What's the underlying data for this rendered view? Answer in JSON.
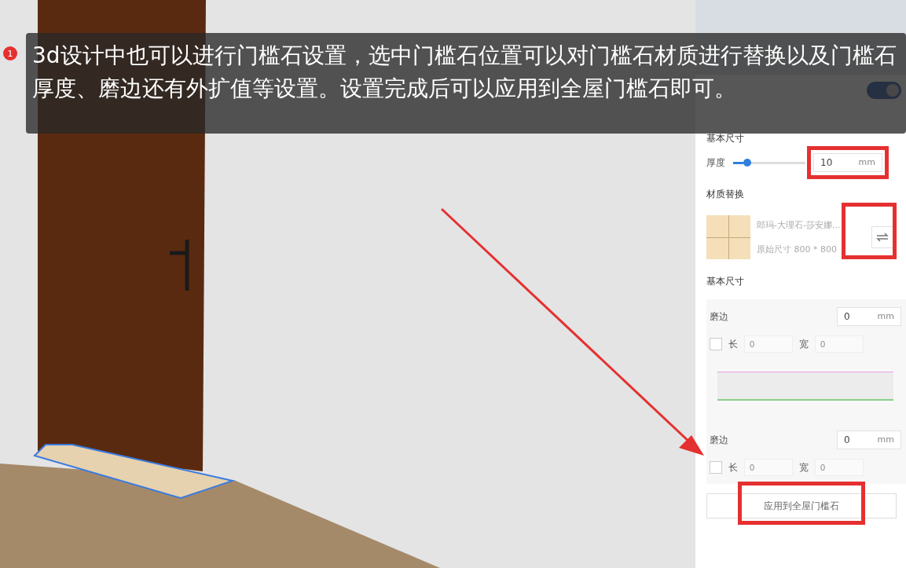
{
  "annotation": {
    "number": "1",
    "text": "3d设计中也可以进行门槛石设置，选中门槛石位置可以对门槛石材质进行替换以及门槛石厚度、磨边还有外扩值等设置。设置完成后可以应用到全屋门槛石即可。"
  },
  "panel": {
    "toggle": {
      "on": true
    },
    "section_1": "基本尺寸",
    "thickness": {
      "label": "厚度",
      "level": 0.2,
      "value": "10",
      "unit": "mm"
    },
    "material_heading": "材质替换",
    "material": {
      "name": "郎玛-大理石-莎安娜...",
      "size": "原始尺寸 800 * 800"
    },
    "section_2": "基本尺寸",
    "edges": [
      {
        "label": "磨边",
        "value": "0",
        "unit": "mm",
        "checked": false,
        "length_label": "长",
        "length_placeholder": "0",
        "width_label": "宽",
        "width_placeholder": "0"
      },
      {
        "label": "磨边",
        "value": "0",
        "unit": "mm",
        "checked": false,
        "length_label": "长",
        "length_placeholder": "0",
        "width_label": "宽",
        "width_placeholder": "0"
      }
    ],
    "apply_button": "应用到全屋门槛石"
  }
}
